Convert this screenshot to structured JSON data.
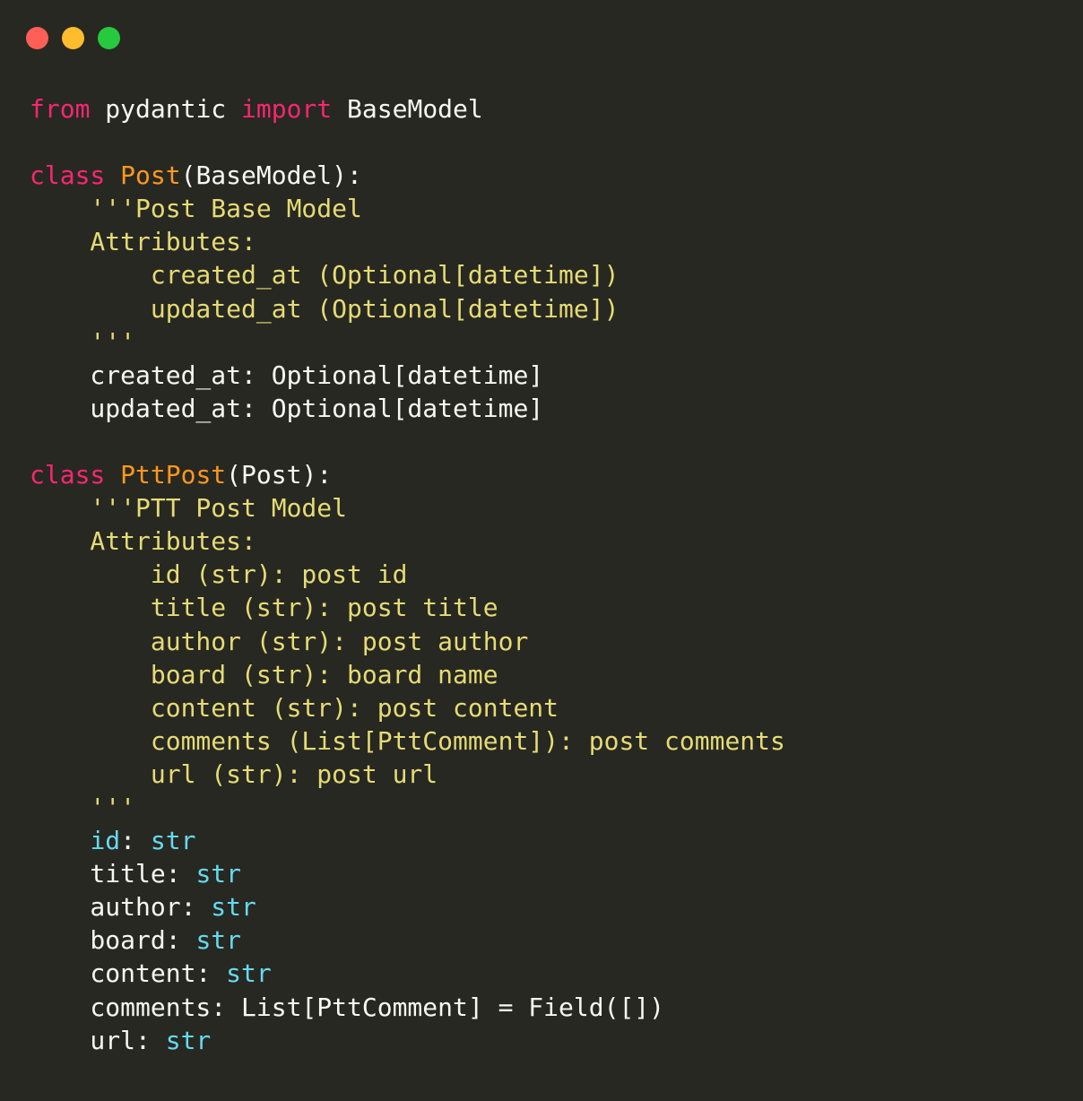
{
  "window": {
    "controls": {
      "close_color": "#FF5F56",
      "minimize_color": "#FFBD2E",
      "zoom_color": "#27C93F"
    },
    "background_color": "#272822"
  },
  "theme": {
    "keyword": "#F92672",
    "class_name": "#FD971F",
    "string": "#E6DB74",
    "type": "#66D9EF",
    "plain": "#F8F8F2"
  },
  "code": {
    "lines": [
      [
        {
          "t": "from",
          "k": "kw"
        },
        {
          "t": " pydantic ",
          "k": "plain"
        },
        {
          "t": "import",
          "k": "kw"
        },
        {
          "t": " BaseModel",
          "k": "plain"
        }
      ],
      [],
      [
        {
          "t": "class",
          "k": "kw"
        },
        {
          "t": " ",
          "k": "plain"
        },
        {
          "t": "Post",
          "k": "cls"
        },
        {
          "t": "(BaseModel):",
          "k": "plain"
        }
      ],
      [
        {
          "t": "    '''Post Base Model",
          "k": "str"
        }
      ],
      [
        {
          "t": "    Attributes:",
          "k": "str"
        }
      ],
      [
        {
          "t": "        created_at (Optional[datetime])",
          "k": "str"
        }
      ],
      [
        {
          "t": "        updated_at (Optional[datetime])",
          "k": "str"
        }
      ],
      [
        {
          "t": "    '''",
          "k": "str"
        }
      ],
      [
        {
          "t": "    created_at: Optional[datetime]",
          "k": "plain"
        }
      ],
      [
        {
          "t": "    updated_at: Optional[datetime]",
          "k": "plain"
        }
      ],
      [],
      [
        {
          "t": "class",
          "k": "kw"
        },
        {
          "t": " ",
          "k": "plain"
        },
        {
          "t": "PttPost",
          "k": "cls"
        },
        {
          "t": "(Post):",
          "k": "plain"
        }
      ],
      [
        {
          "t": "    '''PTT Post Model",
          "k": "str"
        }
      ],
      [
        {
          "t": "    Attributes:",
          "k": "str"
        }
      ],
      [
        {
          "t": "        id (str): post id",
          "k": "str"
        }
      ],
      [
        {
          "t": "        title (str): post title",
          "k": "str"
        }
      ],
      [
        {
          "t": "        author (str): post author",
          "k": "str"
        }
      ],
      [
        {
          "t": "        board (str): board name",
          "k": "str"
        }
      ],
      [
        {
          "t": "        content (str): post content",
          "k": "str"
        }
      ],
      [
        {
          "t": "        comments (List[PttComment]): post comments",
          "k": "str"
        }
      ],
      [
        {
          "t": "        url (str): post url",
          "k": "str"
        }
      ],
      [
        {
          "t": "    '''",
          "k": "str"
        }
      ],
      [
        {
          "t": "    ",
          "k": "plain"
        },
        {
          "t": "id",
          "k": "type"
        },
        {
          "t": ": ",
          "k": "plain"
        },
        {
          "t": "str",
          "k": "type"
        }
      ],
      [
        {
          "t": "    title: ",
          "k": "plain"
        },
        {
          "t": "str",
          "k": "type"
        }
      ],
      [
        {
          "t": "    author: ",
          "k": "plain"
        },
        {
          "t": "str",
          "k": "type"
        }
      ],
      [
        {
          "t": "    board: ",
          "k": "plain"
        },
        {
          "t": "str",
          "k": "type"
        }
      ],
      [
        {
          "t": "    content: ",
          "k": "plain"
        },
        {
          "t": "str",
          "k": "type"
        }
      ],
      [
        {
          "t": "    comments: List[PttComment] = Field([])",
          "k": "plain"
        }
      ],
      [
        {
          "t": "    url: ",
          "k": "plain"
        },
        {
          "t": "str",
          "k": "type"
        }
      ]
    ]
  }
}
